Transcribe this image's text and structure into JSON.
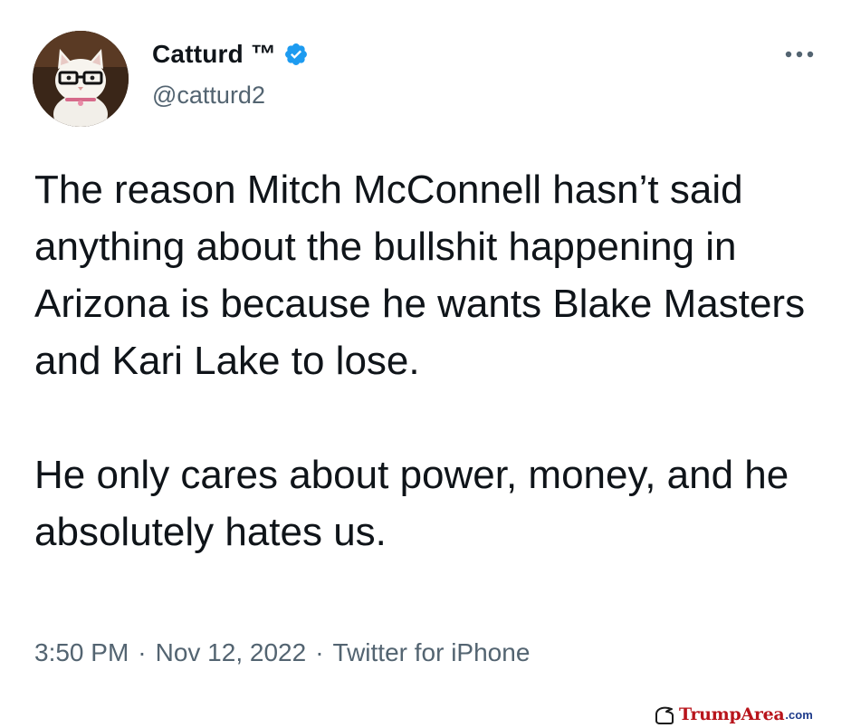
{
  "author": {
    "display_name": "Catturd ™",
    "handle": "@catturd2"
  },
  "icons": {
    "avatar": "cat-with-glasses-avatar",
    "verified": "verified-badge-icon",
    "more": "more-options-icon",
    "watermark_logo": "trump-hair-logo-icon"
  },
  "tweet": {
    "paragraph_1": "The reason Mitch McConnell hasn’t said anything about the bullshit happening in Arizona is because he wants Blake Masters and Kari Lake to lose.",
    "paragraph_2": "He only cares about power, money, and he absolutely hates us."
  },
  "meta": {
    "time": "3:50 PM",
    "separator": "·",
    "date": "Nov 12, 2022",
    "source": "Twitter for iPhone"
  },
  "watermark": {
    "brand": "TrumpArea",
    "suffix": ".com"
  },
  "colors": {
    "text_primary": "#0f1419",
    "text_secondary": "#536471",
    "verified_blue": "#1d9bf0",
    "watermark_red": "#b8141b"
  }
}
